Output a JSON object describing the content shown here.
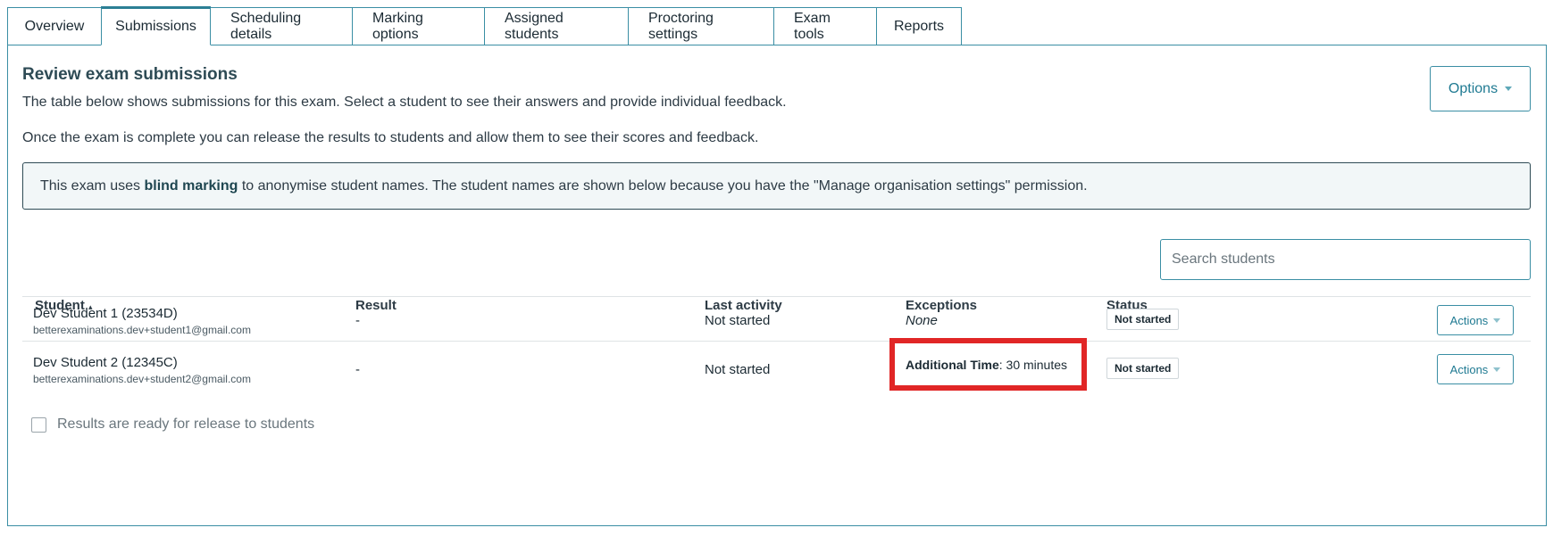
{
  "tabs": [
    {
      "label": "Overview",
      "active": false
    },
    {
      "label": "Submissions",
      "active": true
    },
    {
      "label": "Scheduling details",
      "active": false
    },
    {
      "label": "Marking options",
      "active": false
    },
    {
      "label": "Assigned students",
      "active": false
    },
    {
      "label": "Proctoring settings",
      "active": false
    },
    {
      "label": "Exam tools",
      "active": false
    },
    {
      "label": "Reports",
      "active": false
    }
  ],
  "page": {
    "title": "Review exam submissions",
    "desc1": "The table below shows submissions for this exam. Select a student to see their answers and provide individual feedback.",
    "desc2": "Once the exam is complete you can release the results to students and allow them to see their scores and feedback.",
    "options_label": "Options"
  },
  "notice": {
    "before": "This exam uses ",
    "bold": "blind marking",
    "after": " to anonymise student names. The student names are shown below because you have the \"Manage organisation settings\" permission."
  },
  "search": {
    "placeholder": "Search students"
  },
  "table": {
    "headers": {
      "student": "Student",
      "sort_indicator": "▴",
      "result": "Result",
      "last_activity": "Last activity",
      "exceptions": "Exceptions",
      "status": "Status"
    },
    "rows": [
      {
        "name": "Dev Student 1 (23534D)",
        "email": "betterexaminations.dev+student1@gmail.com",
        "result": "-",
        "last_activity": "Not started",
        "exceptions": "None",
        "status": "Not started",
        "actions": "Actions"
      },
      {
        "name": "Dev Student 2 (12345C)",
        "email": "betterexaminations.dev+student2@gmail.com",
        "result": "-",
        "last_activity": "Not started",
        "exception_label": "Additional Time",
        "exception_value": ": 30 minutes",
        "status": "Not started",
        "actions": "Actions"
      }
    ]
  },
  "release": {
    "label": "Results are ready for release to students",
    "checked": false
  },
  "colors": {
    "accent": "#3a8ea4",
    "highlight": "#e12626",
    "notice_bg": "#f2f7f8"
  }
}
